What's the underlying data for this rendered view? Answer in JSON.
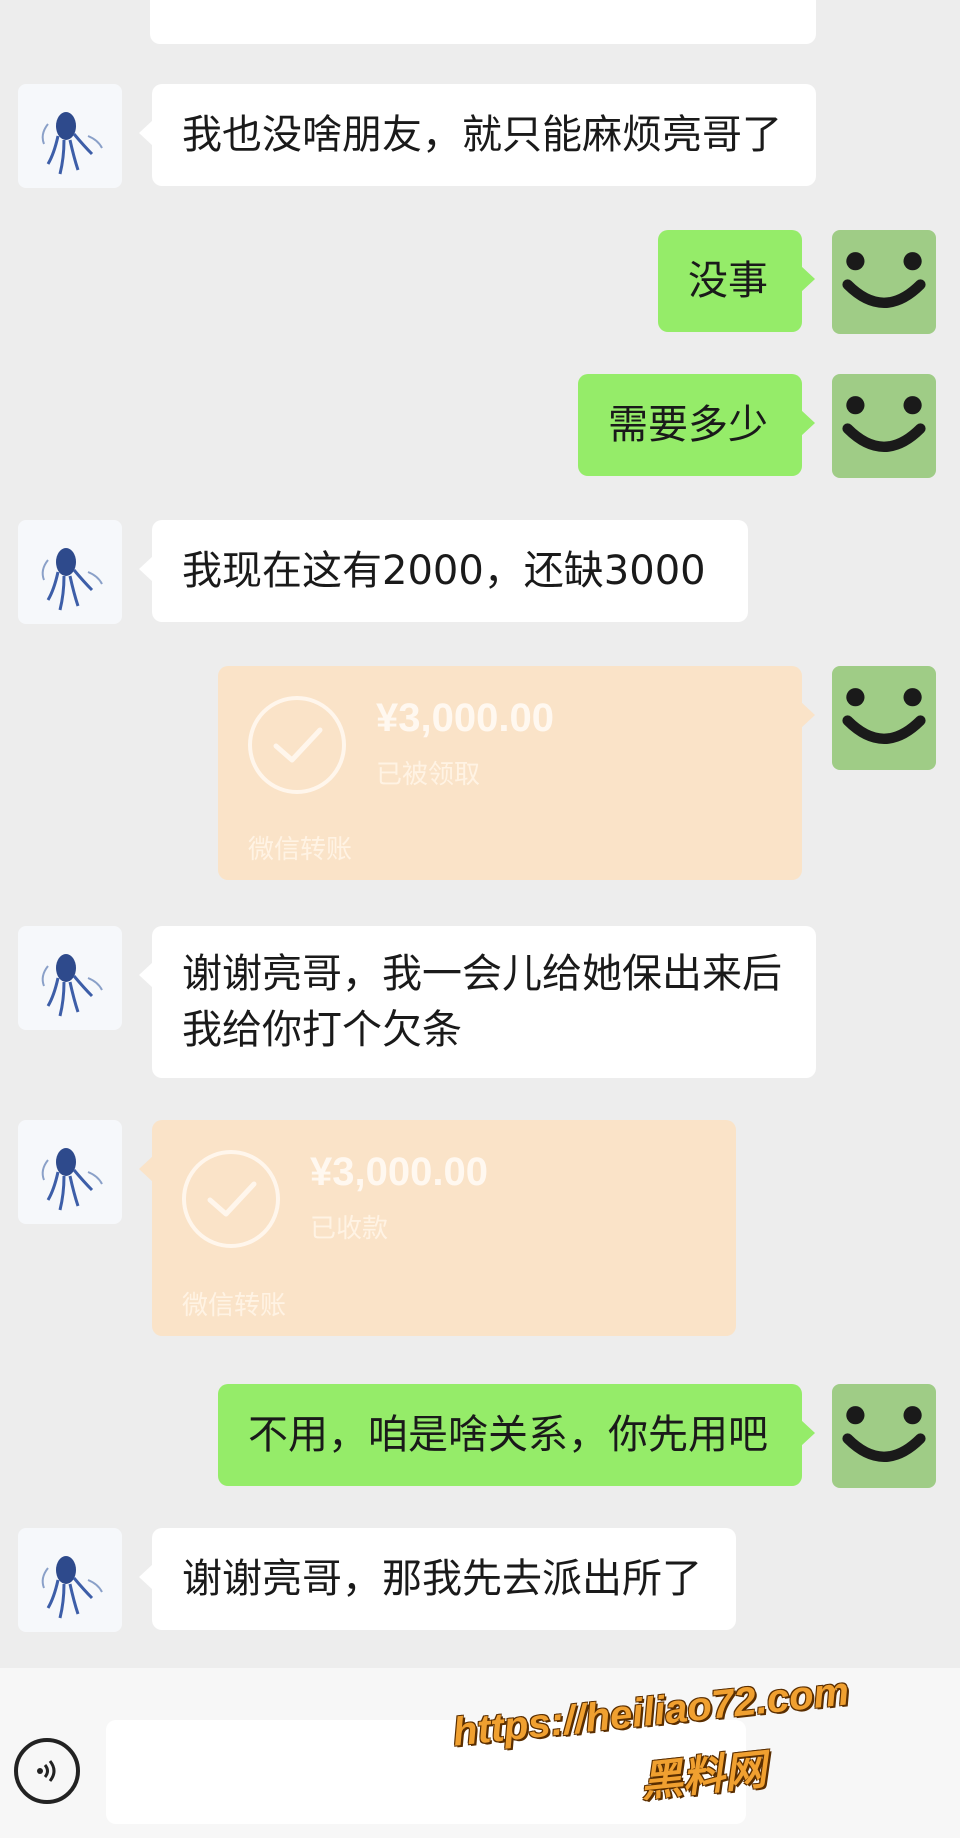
{
  "messages": {
    "m1": "我也没啥朋友，就只能麻烦亮哥了",
    "m2": "没事",
    "m3": "需要多少",
    "m4": "我现在这有2000，还缺3000",
    "m6": "谢谢亮哥，我一会儿给她保出来后我给你打个欠条",
    "m8": "不用，咱是啥关系，你先用吧",
    "m9": "谢谢亮哥，那我先去派出所了"
  },
  "transfers": {
    "t1": {
      "amount": "¥3,000.00",
      "status": "已被领取",
      "source": "微信转账"
    },
    "t2": {
      "amount": "¥3,000.00",
      "status": "已收款",
      "source": "微信转账"
    }
  },
  "self_avatar_glyph": "◡̇",
  "watermark": {
    "url": "https://heiliao72.com",
    "site": "黑料网"
  },
  "icons": {
    "contact_avatar": "jellyfish-avatar-icon",
    "self_avatar": "smiley-avatar-icon",
    "voice": "voice-icon",
    "check": "check-icon"
  },
  "colors": {
    "background": "#ededed",
    "green_bubble": "#95ec69",
    "white_bubble": "#ffffff",
    "transfer_card": "#fae3c8",
    "self_avatar_bg": "#9fcc86",
    "watermark": "#f0a030"
  }
}
